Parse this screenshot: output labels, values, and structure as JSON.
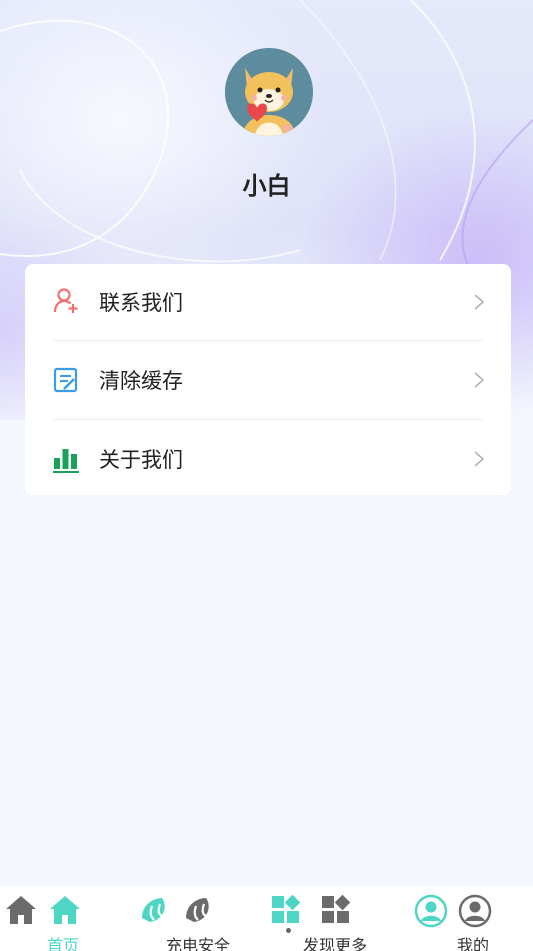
{
  "profile": {
    "name": "小白",
    "avatar_icon": "shiba-dog-avatar"
  },
  "menu": {
    "items": [
      {
        "label": "联系我们",
        "icon": "person-add-icon",
        "icon_color": "#f07070"
      },
      {
        "label": "清除缓存",
        "icon": "edit-document-icon",
        "icon_color": "#3a9ce6"
      },
      {
        "label": "关于我们",
        "icon": "bar-chart-icon",
        "icon_color": "#1aa25a"
      }
    ]
  },
  "tabbar": {
    "accent": "#4dd6c4",
    "inactive": "#6b6b6b",
    "tabs": [
      {
        "label": "首页",
        "icon": "home-icon",
        "active": true
      },
      {
        "label": "充电安全",
        "icon": "leaf-icon",
        "active": false
      },
      {
        "label": "发现更多",
        "icon": "apps-grid-icon",
        "active": false
      },
      {
        "label": "我的",
        "icon": "person-circle-icon",
        "active": false
      }
    ]
  }
}
